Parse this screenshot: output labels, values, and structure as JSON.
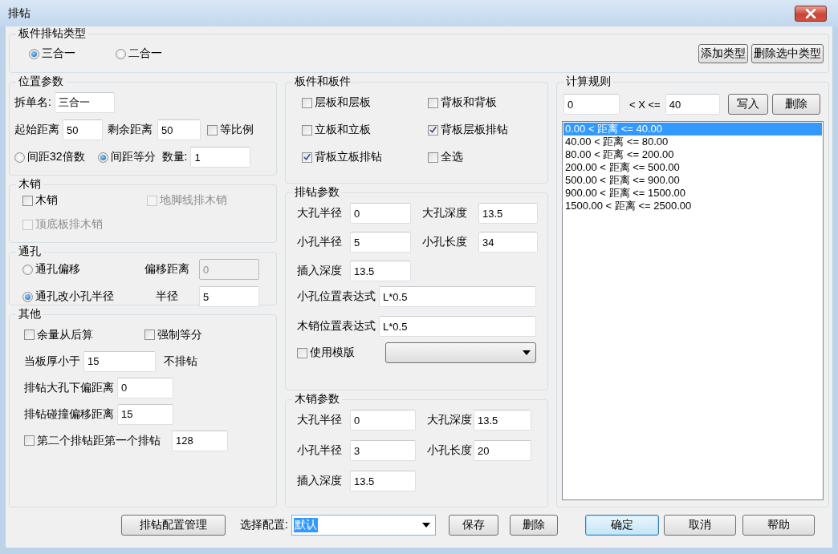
{
  "window": {
    "title": "排钻"
  },
  "board_type": {
    "title": "板件排钻类型",
    "options": [
      {
        "label": "三合一",
        "selected": true
      },
      {
        "label": "二合一",
        "selected": false
      }
    ],
    "buttons": [
      "添加类型",
      "删除选中类型"
    ]
  },
  "position": {
    "title": "位置参数",
    "split_name": {
      "label": "拆单名:",
      "value": "三合一"
    },
    "start": {
      "label": "起始距离",
      "value": "50"
    },
    "rest": {
      "label": "剩余距离",
      "value": "50"
    },
    "proportional": {
      "label": "等比例",
      "checked": false
    },
    "spacing": [
      {
        "label": "间距32倍数",
        "selected": false
      },
      {
        "label": "间距等分",
        "selected": true
      }
    ],
    "count": {
      "label": "数量:",
      "value": "1"
    }
  },
  "dowel": {
    "title": "木销",
    "options": [
      {
        "label": "木销",
        "checked": false,
        "disabled": false
      },
      {
        "label": "地脚线排木销",
        "checked": false,
        "disabled": true
      },
      {
        "label": "顶底板排木销",
        "checked": false,
        "disabled": true
      }
    ]
  },
  "through_hole": {
    "title": "通孔",
    "options": [
      {
        "label": "通孔偏移",
        "selected": false
      },
      {
        "label": "通孔改小孔半径",
        "selected": true
      }
    ],
    "fields": [
      {
        "label": "偏移距离",
        "value": "0",
        "disabled": true
      },
      {
        "label": "半径",
        "value": "5",
        "disabled": false
      }
    ]
  },
  "other": {
    "title": "其他",
    "checks": [
      {
        "label": "余量从后算",
        "checked": false
      },
      {
        "label": "强制等分",
        "checked": false
      }
    ],
    "thickness": {
      "label": "当板厚小于",
      "value": "15",
      "suffix": "不排钻"
    },
    "big_hole_offset": {
      "label": "排钻大孔下偏距离",
      "value": "0"
    },
    "collision_offset": {
      "label": "排钻碰撞偏移距离",
      "value": "15"
    },
    "second_drill": {
      "label": "第二个排钻距第一个排钻",
      "checked": false,
      "value": "128"
    }
  },
  "boards": {
    "title": "板件和板件",
    "options": [
      {
        "label": "层板和层板",
        "checked": false
      },
      {
        "label": "背板和背板",
        "checked": false
      },
      {
        "label": "立板和立板",
        "checked": false
      },
      {
        "label": "背板层板排钻",
        "checked": true
      },
      {
        "label": "背板立板排钻",
        "checked": true
      },
      {
        "label": "全选",
        "checked": false
      }
    ]
  },
  "drill_params": {
    "title": "排钻参数",
    "fields": [
      {
        "label": "大孔半径",
        "value": "0"
      },
      {
        "label": "大孔深度",
        "value": "13.5"
      },
      {
        "label": "小孔半径",
        "value": "5"
      },
      {
        "label": "小孔长度",
        "value": "34"
      },
      {
        "label": "插入深度",
        "value": "13.5"
      }
    ],
    "expressions": [
      {
        "label": "小孔位置表达式",
        "value": "L*0.5"
      },
      {
        "label": "木销位置表达式",
        "value": "L*0.5"
      }
    ],
    "template": {
      "label": "使用模版",
      "checked": false
    }
  },
  "dowel_params": {
    "title": "木销参数",
    "fields": [
      {
        "label": "大孔半径",
        "value": "0"
      },
      {
        "label": "大孔深度",
        "value": "13.5"
      },
      {
        "label": "小孔半径",
        "value": "3"
      },
      {
        "label": "小孔长度",
        "value": "20"
      },
      {
        "label": "插入深度",
        "value": "13.5"
      }
    ]
  },
  "rules": {
    "title": "计算规则",
    "from": "0",
    "operator": "< X <=",
    "to": "40",
    "buttons": [
      "写入",
      "删除"
    ],
    "items": [
      {
        "text": "0.00 < 距离 <= 40.00",
        "selected": true
      },
      {
        "text": "40.00 < 距离 <= 80.00",
        "selected": false
      },
      {
        "text": "80.00 < 距离 <= 200.00",
        "selected": false
      },
      {
        "text": "200.00 < 距离 <= 500.00",
        "selected": false
      },
      {
        "text": "500.00 < 距离 <= 900.00",
        "selected": false
      },
      {
        "text": "900.00 < 距离 <= 1500.00",
        "selected": false
      },
      {
        "text": "1500.00 < 距离 <= 2500.00",
        "selected": false
      }
    ]
  },
  "footer": {
    "manage_button": "排钻配置管理",
    "config_label": "选择配置:",
    "config": {
      "value": "默认",
      "highlighted": true
    },
    "buttons": [
      {
        "label": "保存",
        "default": false
      },
      {
        "label": "删除",
        "default": false
      },
      {
        "label": "确定",
        "default": true
      },
      {
        "label": "取消",
        "default": false
      },
      {
        "label": "帮助",
        "default": false
      }
    ]
  }
}
